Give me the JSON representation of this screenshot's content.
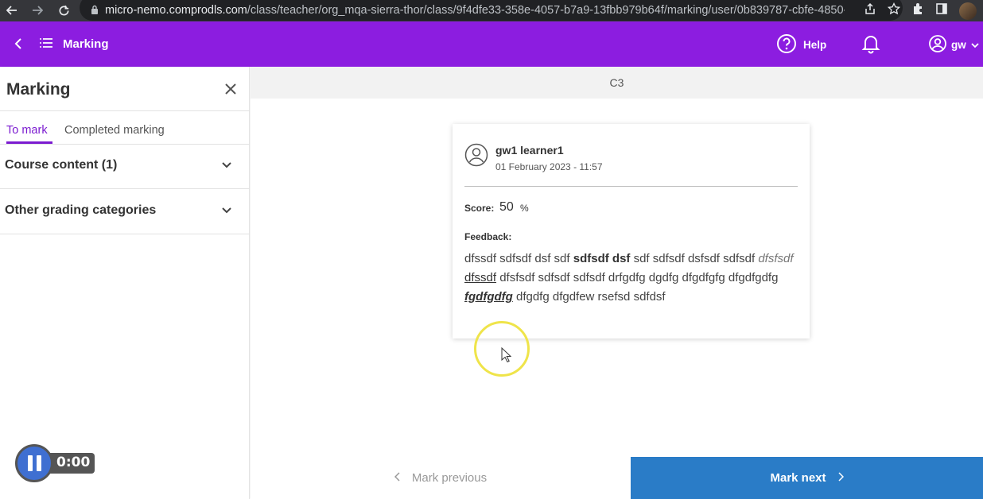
{
  "browser": {
    "url_host": "micro-nemo.comprodls.com",
    "url_path": "/class/teacher/org_mqa-sierra-thor/class/9f4dfe33-358e-4057-b7a9-13fbb979b64f/marking/user/0b839787-cbfe-4850-..."
  },
  "header": {
    "title": "Marking",
    "help_label": "Help",
    "user_label": "gw"
  },
  "sidebar": {
    "title": "Marking",
    "tabs": [
      {
        "label": "To mark",
        "active": true
      },
      {
        "label": "Completed marking",
        "active": false
      }
    ],
    "sections": [
      {
        "label": "Course content (1)"
      },
      {
        "label": "Other grading categories"
      }
    ]
  },
  "main": {
    "topbar_title": "C3",
    "card": {
      "learner_name": "gw1 learner1",
      "date": "01 February 2023 - 11:57",
      "score_label": "Score:",
      "score_value": "50",
      "score_unit": "%",
      "feedback_label": "Feedback:",
      "feedback": {
        "plain1": "dfssdf sdfsdf dsf sdf ",
        "bold1": "sdfsdf dsf",
        "plain2": " sdf sdfsdf dsfsdf sdfsdf ",
        "italic1": "dfsfsdf",
        "plain3": " ",
        "underline1": "dfssdf",
        "plain4": " dfsfsdf sdfsdf sdfsdf drfgdfg dgdfg dfgdfgfg dfgdfgdfg",
        "bold_italic_underline": " fgdfgdfg",
        "plain5": " dfgdfg dfgdfew rsefsd sdfdsf"
      }
    }
  },
  "footer": {
    "prev_label": "Mark previous",
    "next_label": "Mark next"
  },
  "recorder": {
    "time": "0:00"
  },
  "colors": {
    "brand_purple": "#8c1de0",
    "accent_blue": "#2a7cc7",
    "tab_active": "#7b1bd0"
  }
}
